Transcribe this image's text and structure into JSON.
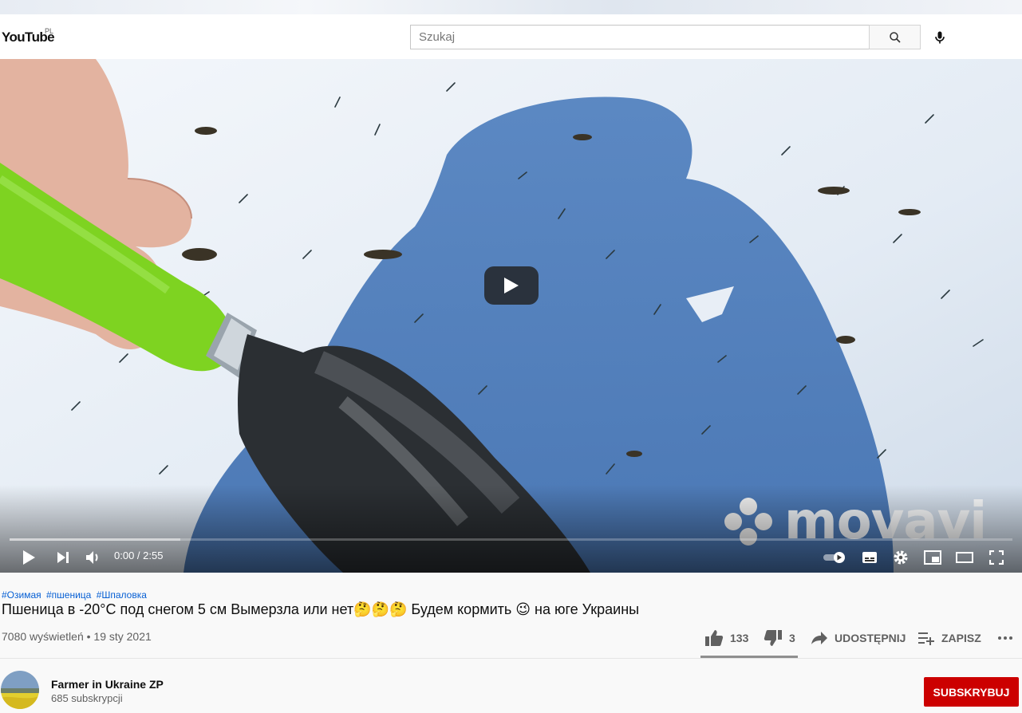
{
  "masthead": {
    "logo_text": "YouTube",
    "country_code": "PL",
    "search_placeholder": "Szukaj"
  },
  "player": {
    "watermark": "movavi",
    "time_current": "0:00",
    "time_total": "2:55",
    "time_display": "0:00 / 2:55",
    "progress_loaded_fraction": 0.17,
    "icons": [
      "play-icon",
      "next-icon",
      "volume-icon",
      "autoplay-toggle-icon",
      "subtitles-icon",
      "settings-icon",
      "miniplayer-icon",
      "theater-icon",
      "fullscreen-icon"
    ]
  },
  "video": {
    "hashtags": [
      "#Озимая",
      "#пшеница",
      "#Шпаловка"
    ],
    "title": "Пшеница в -20°С под снегом 5 см Вымерзла или нет🤔🤔🤔 Будем кормить 😉 на юге Украины",
    "views": "7080 wyświetleń",
    "separator": "•",
    "date": "19 sty 2021",
    "meta_line": "7080 wyświetleń • 19 sty 2021"
  },
  "actions": {
    "likes": "133",
    "dislikes": "3",
    "share_label": "UDOSTĘPNIJ",
    "save_label": "ZAPISZ",
    "like_fraction": 0.978
  },
  "channel": {
    "name": "Farmer in Ukraine ZP",
    "subscribers": "685 subskrypcji",
    "subscribe_label": "SUBSKRYBUJ"
  },
  "colors": {
    "subscribe_red": "#cc0000",
    "hashtag_blue": "#065fd4",
    "handle_green": "#7ed321"
  }
}
